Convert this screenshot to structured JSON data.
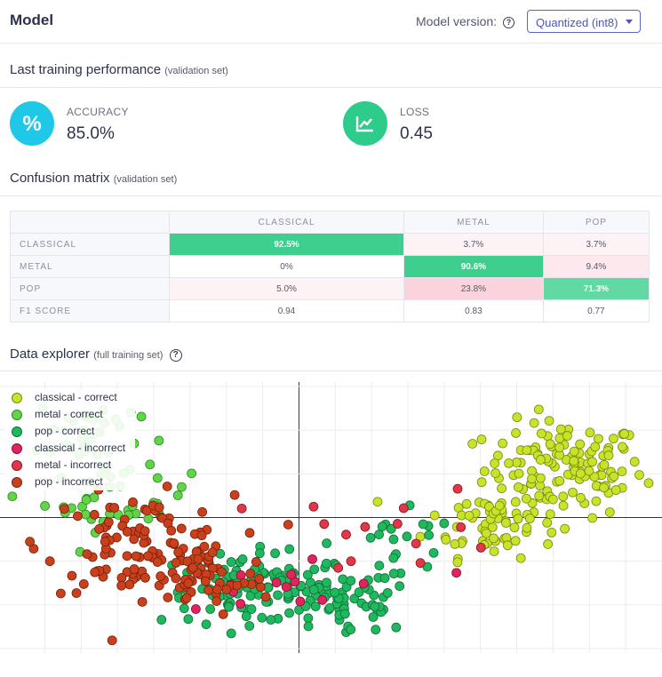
{
  "header": {
    "title": "Model",
    "model_version_label": "Model version:",
    "help_icon": "?",
    "version_selected": "Quantized (int8)"
  },
  "performance": {
    "title": "Last training performance",
    "subtitle": "(validation set)",
    "accuracy": {
      "icon": "percent-icon",
      "symbol": "%",
      "label": "ACCURACY",
      "value": "85.0%",
      "color": "#1ec8e6"
    },
    "loss": {
      "icon": "chart-line-icon",
      "label": "LOSS",
      "value": "0.45",
      "color": "#2ecc8a"
    }
  },
  "confusion": {
    "title": "Confusion matrix",
    "subtitle": "(validation set)",
    "columns": [
      "CLASSICAL",
      "METAL",
      "POP"
    ],
    "rows": [
      {
        "label": "CLASSICAL",
        "cells": [
          "92.5%",
          "3.7%",
          "3.7%"
        ]
      },
      {
        "label": "METAL",
        "cells": [
          "0%",
          "90.6%",
          "9.4%"
        ]
      },
      {
        "label": "POP",
        "cells": [
          "5.0%",
          "23.8%",
          "71.3%"
        ]
      },
      {
        "label": "F1 SCORE",
        "cells": [
          "0.94",
          "0.83",
          "0.77"
        ]
      }
    ],
    "colors": {
      "strong": "#3ecf8e",
      "medium": "#62d9a2",
      "pink_light": "#fdf2f4",
      "pink_mid": "#fbd9e1"
    }
  },
  "explorer": {
    "title": "Data explorer",
    "subtitle": "(full training set)",
    "help_icon": "?",
    "legend": [
      {
        "label": "classical - correct",
        "color": "#c9e22a"
      },
      {
        "label": "metal - correct",
        "color": "#62d44a"
      },
      {
        "label": "pop - correct",
        "color": "#1fb85e"
      },
      {
        "label": "classical - incorrect",
        "color": "#e0245e"
      },
      {
        "label": "metal - incorrect",
        "color": "#e03848"
      },
      {
        "label": "pop - incorrect",
        "color": "#c8401c"
      }
    ]
  },
  "chart_data": {
    "type": "scatter",
    "grid": true,
    "xlim": [
      -7.5,
      10
    ],
    "ylim": [
      -3,
      3
    ],
    "series": [
      {
        "name": "classical - correct",
        "clusters": [
          {
            "cx": 7.3,
            "cy": 1.1,
            "sx": 1.1,
            "sy": 0.55,
            "n": 130
          },
          {
            "cx": 5.3,
            "cy": -0.1,
            "sx": 0.9,
            "sy": 0.4,
            "n": 60
          }
        ]
      },
      {
        "name": "metal - correct",
        "clusters": [
          {
            "cx": -5.8,
            "cy": 1.9,
            "sx": 0.7,
            "sy": 0.5,
            "n": 40
          },
          {
            "cx": -5.0,
            "cy": 0.4,
            "sx": 1.0,
            "sy": 0.35,
            "n": 35
          }
        ]
      },
      {
        "name": "pop - correct",
        "clusters": [
          {
            "cx": -1.4,
            "cy": -1.6,
            "sx": 1.2,
            "sy": 0.4,
            "n": 90
          },
          {
            "cx": 1.2,
            "cy": -1.9,
            "sx": 1.0,
            "sy": 0.4,
            "n": 70
          },
          {
            "cx": 2.8,
            "cy": -0.7,
            "sx": 0.8,
            "sy": 0.4,
            "n": 20
          }
        ]
      },
      {
        "name": "classical - incorrect",
        "clusters": [
          {
            "cx": 0.0,
            "cy": -1.6,
            "sx": 1.8,
            "sy": 0.5,
            "n": 14
          }
        ]
      },
      {
        "name": "metal - incorrect",
        "clusters": [
          {
            "cx": 2.7,
            "cy": -0.3,
            "sx": 1.5,
            "sy": 0.5,
            "n": 14
          }
        ]
      },
      {
        "name": "pop - incorrect",
        "clusters": [
          {
            "cx": -4.4,
            "cy": -0.6,
            "sx": 1.3,
            "sy": 0.55,
            "n": 100
          },
          {
            "cx": -2.8,
            "cy": -1.4,
            "sx": 1.0,
            "sy": 0.45,
            "n": 55
          }
        ]
      }
    ]
  }
}
